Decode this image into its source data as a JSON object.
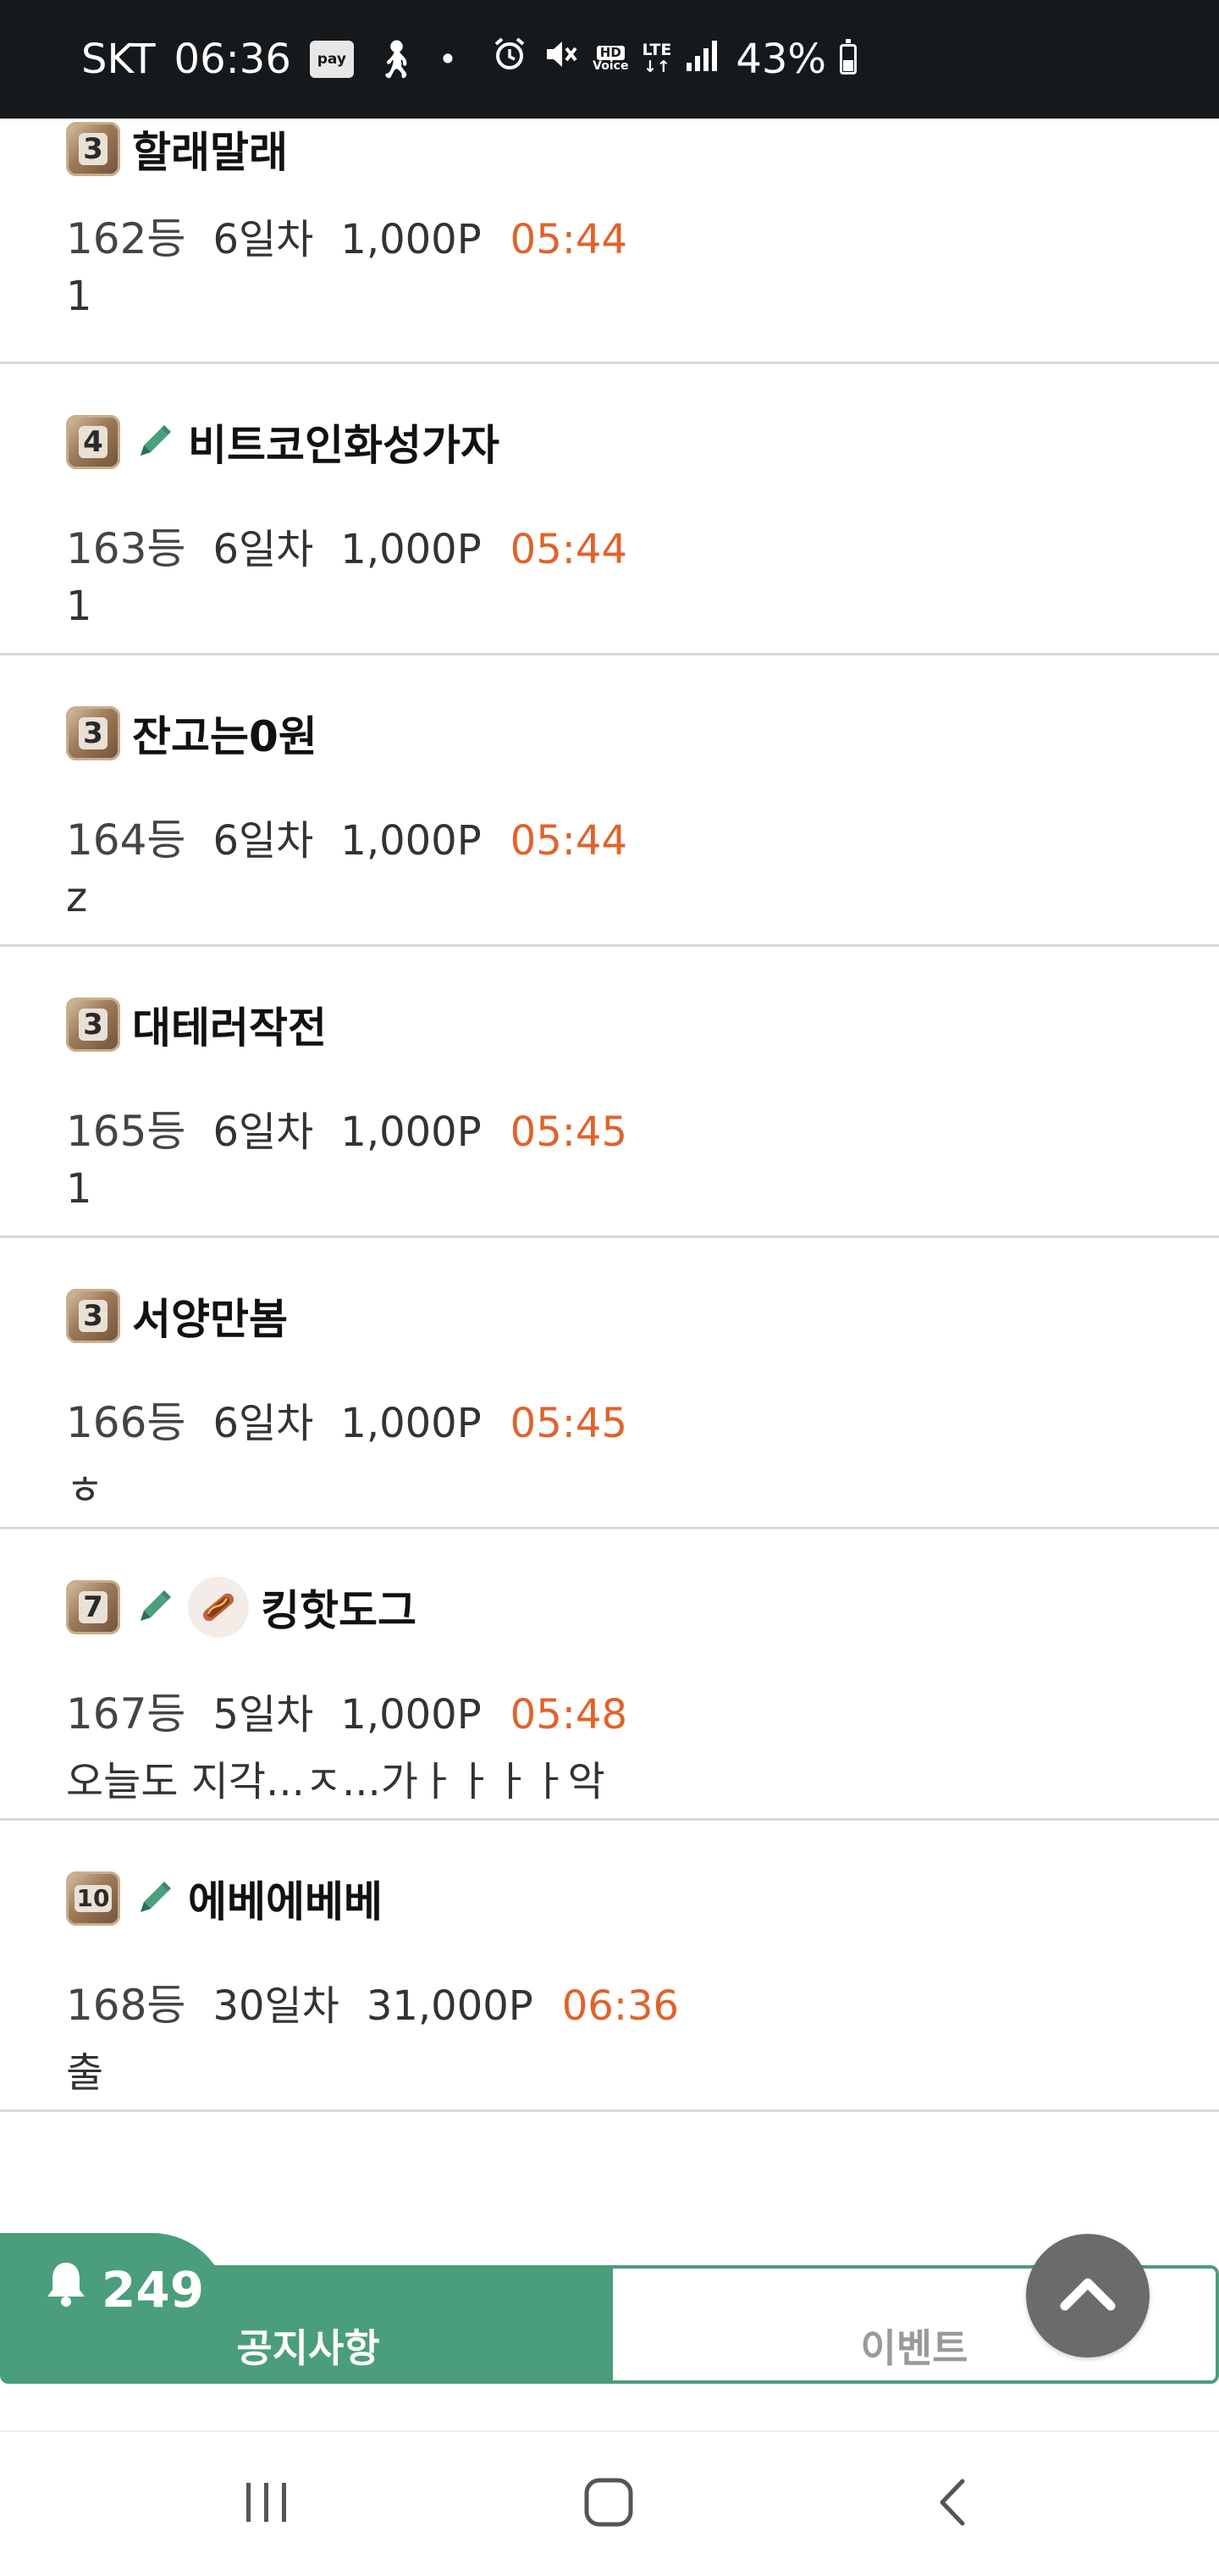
{
  "status_bar": {
    "carrier": "SKT",
    "time": "06:36",
    "pay_label": "pay",
    "hd_label": "HD",
    "voice_label": "Voice",
    "lte_label": "LTE",
    "battery": "43%"
  },
  "feed": {
    "items": [
      {
        "level": "3",
        "name": "할래말래",
        "rank": "162등",
        "days": "6일차",
        "points": "1,000P",
        "time": "05:44",
        "comment": "1",
        "pencil": false,
        "avatar": false
      },
      {
        "level": "4",
        "name": "비트코인화성가자",
        "rank": "163등",
        "days": "6일차",
        "points": "1,000P",
        "time": "05:44",
        "comment": "1",
        "pencil": true,
        "avatar": false
      },
      {
        "level": "3",
        "name": "잔고는0원",
        "rank": "164등",
        "days": "6일차",
        "points": "1,000P",
        "time": "05:44",
        "comment": "z",
        "pencil": false,
        "avatar": false
      },
      {
        "level": "3",
        "name": "대테러작전",
        "rank": "165등",
        "days": "6일차",
        "points": "1,000P",
        "time": "05:45",
        "comment": "1",
        "pencil": false,
        "avatar": false
      },
      {
        "level": "3",
        "name": "서양만봄",
        "rank": "166등",
        "days": "6일차",
        "points": "1,000P",
        "time": "05:45",
        "comment": "ㅎ",
        "pencil": false,
        "avatar": false
      },
      {
        "level": "7",
        "name": "킹핫도그",
        "rank": "167등",
        "days": "5일차",
        "points": "1,000P",
        "time": "05:48",
        "comment": "오늘도 지각...ㅈ...가ㅏㅏㅏㅏ악",
        "pencil": true,
        "avatar": true
      },
      {
        "level": "10",
        "name": "에베에베베",
        "rank": "168등",
        "days": "30일차",
        "points": "31,000P",
        "time": "06:36",
        "comment": "출",
        "pencil": true,
        "avatar": false
      }
    ]
  },
  "bottom_tabs": {
    "notification_count": "249",
    "notice_label": "공지사항",
    "event_label": "이벤트"
  },
  "colors": {
    "accent_green": "#4a9e7b",
    "time_orange": "#e0632a"
  },
  "icons": {
    "bell": "bell-icon",
    "pencil": "pencil-icon",
    "scroll_top": "chevron-up-icon",
    "nav_recent": "recent-apps-icon",
    "nav_home": "home-icon",
    "nav_back": "back-icon"
  }
}
